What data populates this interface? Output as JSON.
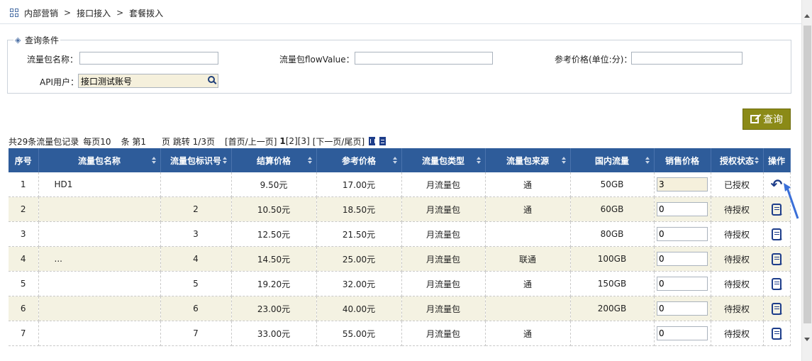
{
  "breadcrumb": [
    "内部营销",
    "接口接入",
    "套餐拨入"
  ],
  "breadcrumb_sep": ">",
  "conditions": {
    "legend": "查询条件",
    "name_label": "流量包名称：",
    "name_value": "",
    "flow_label": "流量包flowValue：",
    "flow_value": "",
    "price_label": "参考价格(单位:分)：",
    "price_value": "",
    "api_label": "API用户：",
    "api_value": "接口测试账号"
  },
  "query_button": "查询",
  "pager": {
    "total_text": "共29条流量包记录",
    "per_page_text": "每页10",
    "page_prefix": "条 第1",
    "page_suffix": "页 跳转 1/3页",
    "first_prev": "[首页/上一页]",
    "page1": "1",
    "page2": "[2]",
    "page3": "[3]",
    "next_last": "[下一页/尾页]"
  },
  "table": {
    "columns": [
      "序号",
      "流量包名称",
      "流量包标识号",
      "结算价格",
      "参考价格",
      "流量包类型",
      "流量包来源",
      "国内流量",
      "销售价格",
      "授权状态",
      "操作"
    ],
    "rows": [
      {
        "seq": "1",
        "name": "HD1",
        "code": "",
        "settle": "9.50元",
        "ref": "17.00元",
        "type": "月流量包",
        "source": "通",
        "domestic": "50GB",
        "sale": "3",
        "status": "已授权",
        "action": "revoke"
      },
      {
        "seq": "2",
        "name": "",
        "code": "2",
        "settle": "10.50元",
        "ref": "18.50元",
        "type": "月流量包",
        "source": "通",
        "domestic": "60GB",
        "sale": "0",
        "status": "待授权",
        "action": "grant"
      },
      {
        "seq": "3",
        "name": "",
        "code": "3",
        "settle": "12.50元",
        "ref": "21.50元",
        "type": "月流量包",
        "source": "",
        "domestic": "80GB",
        "sale": "0",
        "status": "待授权",
        "action": "grant"
      },
      {
        "seq": "4",
        "name": "...",
        "code": "4",
        "settle": "14.50元",
        "ref": "25.00元",
        "type": "月流量包",
        "source": "联通",
        "domestic": "100GB",
        "sale": "0",
        "status": "待授权",
        "action": "grant"
      },
      {
        "seq": "5",
        "name": "",
        "code": "5",
        "settle": "19.20元",
        "ref": "32.00元",
        "type": "月流量包",
        "source": "通",
        "domestic": "150GB",
        "sale": "0",
        "status": "待授权",
        "action": "grant"
      },
      {
        "seq": "6",
        "name": "",
        "code": "6",
        "settle": "23.00元",
        "ref": "40.00元",
        "type": "月流量包",
        "source": "",
        "domestic": "200GB",
        "sale": "0",
        "status": "待授权",
        "action": "grant"
      },
      {
        "seq": "7",
        "name": "",
        "code": "7",
        "settle": "33.00元",
        "ref": "55.00元",
        "type": "月流量包",
        "source": "通",
        "domestic": "",
        "sale": "0",
        "status": "待授权",
        "action": "grant"
      }
    ]
  }
}
